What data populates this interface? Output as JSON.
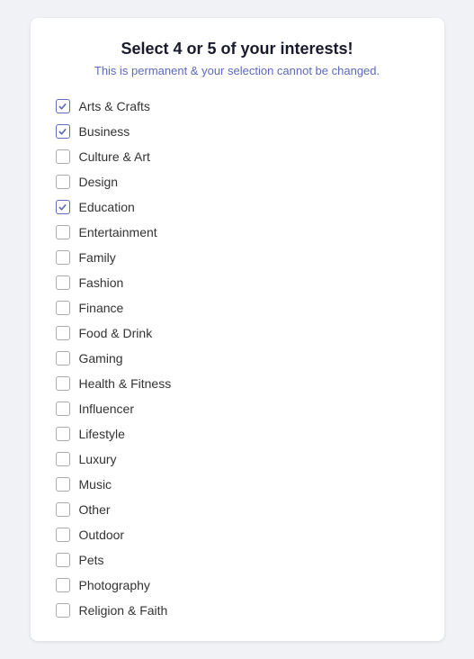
{
  "header": {
    "title": "Select 4 or 5 of your interests!",
    "subtitle": "This is permanent & your selection cannot be changed."
  },
  "interests": [
    {
      "id": "arts-crafts",
      "label": "Arts & Crafts",
      "checked": true
    },
    {
      "id": "business",
      "label": "Business",
      "checked": true
    },
    {
      "id": "culture-art",
      "label": "Culture & Art",
      "checked": false
    },
    {
      "id": "design",
      "label": "Design",
      "checked": false
    },
    {
      "id": "education",
      "label": "Education",
      "checked": true
    },
    {
      "id": "entertainment",
      "label": "Entertainment",
      "checked": false
    },
    {
      "id": "family",
      "label": "Family",
      "checked": false
    },
    {
      "id": "fashion",
      "label": "Fashion",
      "checked": false
    },
    {
      "id": "finance",
      "label": "Finance",
      "checked": false
    },
    {
      "id": "food-drink",
      "label": "Food & Drink",
      "checked": false
    },
    {
      "id": "gaming",
      "label": "Gaming",
      "checked": false
    },
    {
      "id": "health-fitness",
      "label": "Health & Fitness",
      "checked": false
    },
    {
      "id": "influencer",
      "label": "Influencer",
      "checked": false
    },
    {
      "id": "lifestyle",
      "label": "Lifestyle",
      "checked": false
    },
    {
      "id": "luxury",
      "label": "Luxury",
      "checked": false
    },
    {
      "id": "music",
      "label": "Music",
      "checked": false
    },
    {
      "id": "other",
      "label": "Other",
      "checked": false
    },
    {
      "id": "outdoor",
      "label": "Outdoor",
      "checked": false
    },
    {
      "id": "pets",
      "label": "Pets",
      "checked": false
    },
    {
      "id": "photography",
      "label": "Photography",
      "checked": false
    },
    {
      "id": "religion-faith",
      "label": "Religion & Faith",
      "checked": false
    }
  ]
}
